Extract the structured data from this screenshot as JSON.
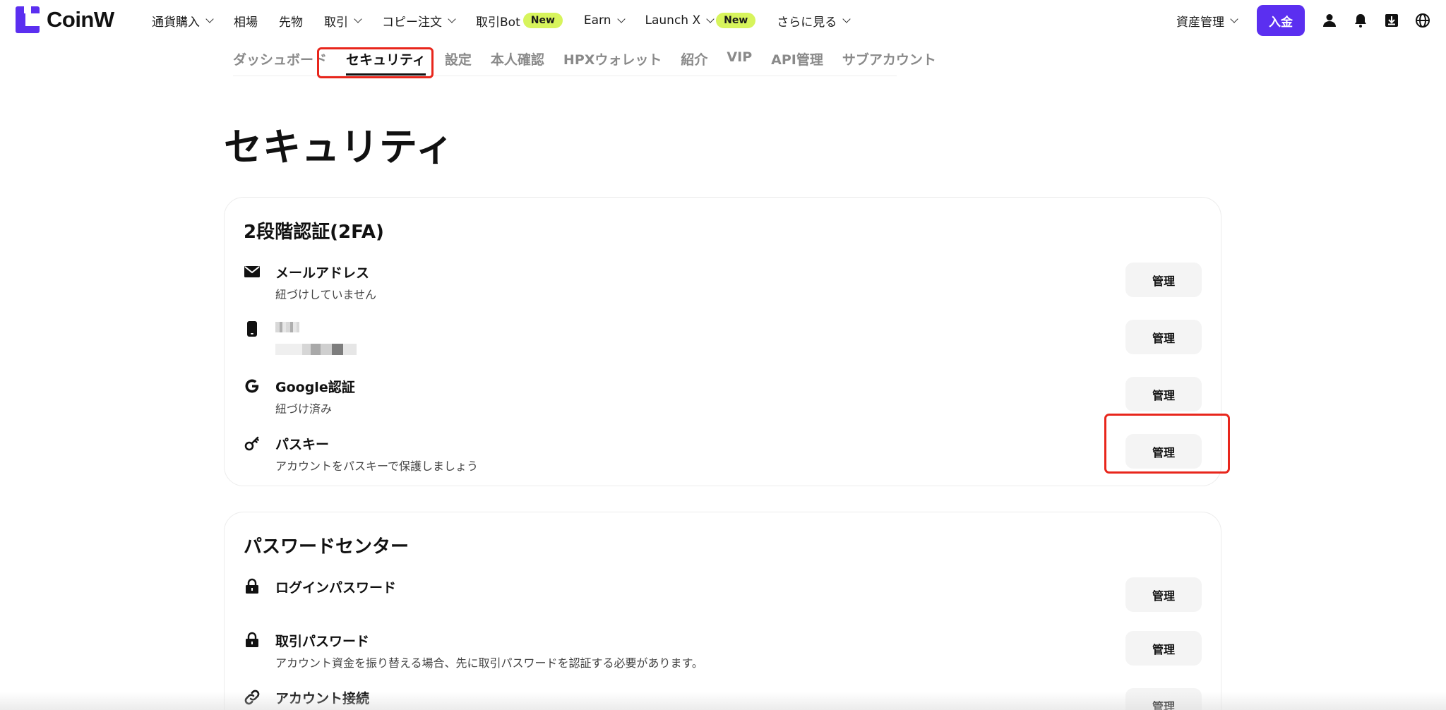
{
  "brand": {
    "name": "CoinW",
    "color": "#5b2ff0"
  },
  "nav": {
    "buy_crypto": "通貨購入",
    "markets": "相場",
    "futures": "先物",
    "trade": "取引",
    "copy_trading": "コピー注文",
    "trading_bot": "取引Bot",
    "bot_badge": "New",
    "earn": "Earn",
    "launch_x": "Launch X",
    "launch_badge": "New",
    "more": "さらに見る"
  },
  "right_nav": {
    "assets": "資産管理",
    "deposit": "入金",
    "icons": [
      "user-icon",
      "bell-icon",
      "download-icon",
      "globe-icon"
    ]
  },
  "subtabs": {
    "items": [
      "ダッシュボード",
      "セキュリティ",
      "設定",
      "本人確認",
      "HPXウォレット",
      "紹介",
      "VIP",
      "API管理",
      "サブアカウント"
    ],
    "active": "セキュリティ"
  },
  "page": {
    "title": "セキュリティ"
  },
  "two_fa": {
    "title": "2段階認証(2FA)",
    "rows": [
      {
        "icon": "mail-icon",
        "title": "メールアドレス",
        "subtitle": "紐づけしていません",
        "button": "管理"
      },
      {
        "icon": "phone-icon",
        "title": "",
        "subtitle": "",
        "button": "管理"
      },
      {
        "icon": "google-icon",
        "title": "Google認証",
        "subtitle": "紐づけ済み",
        "button": "管理"
      },
      {
        "icon": "key-icon",
        "title": "パスキー",
        "subtitle": "アカウントをパスキーで保護しましょう",
        "button": "管理"
      }
    ]
  },
  "password_center": {
    "title": "パスワードセンター",
    "rows": [
      {
        "icon": "lock-icon",
        "title": "ログインパスワード",
        "subtitle": "",
        "button": "管理"
      },
      {
        "icon": "lock-icon",
        "title": "取引パスワード",
        "subtitle": "アカウント資金を振り替える場合、先に取引パスワードを認証する必要があります。",
        "button": "管理"
      },
      {
        "icon": "link-icon",
        "title": "アカウント接続",
        "subtitle": "",
        "button": "管理"
      }
    ]
  },
  "colors": {
    "accent": "#5b2ff0",
    "new_badge": "#d7f45c",
    "highlight": "#e8261c"
  }
}
